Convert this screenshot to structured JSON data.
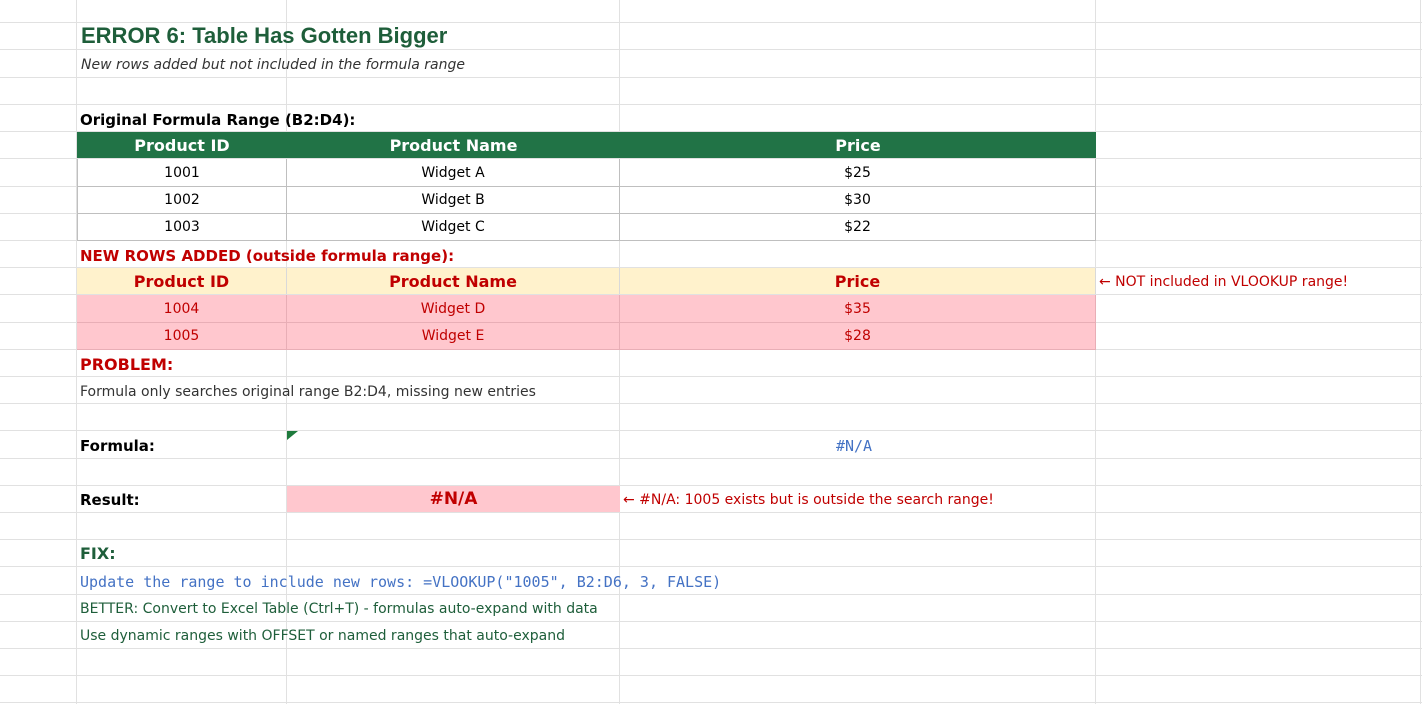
{
  "sheet": {
    "title": "ERROR 6: Table Has Gotten Bigger",
    "subtitle": "New rows added but not included in the formula range",
    "original_label": "Original Formula Range (B2:D4):",
    "columns": [
      "Product ID",
      "Product Name",
      "Price"
    ],
    "original_rows": [
      {
        "id": "1001",
        "name": "Widget A",
        "price": "$25"
      },
      {
        "id": "1002",
        "name": "Widget B",
        "price": "$30"
      },
      {
        "id": "1003",
        "name": "Widget C",
        "price": "$22"
      }
    ],
    "new_rows_label": "NEW ROWS ADDED (outside formula range):",
    "new_rows": [
      {
        "id": "1004",
        "name": "Widget D",
        "price": "$35"
      },
      {
        "id": "1005",
        "name": "Widget E",
        "price": "$28"
      }
    ],
    "new_rows_note": "← NOT included in VLOOKUP range!",
    "problem_label": "PROBLEM:",
    "problem_text": "Formula only searches original range B2:D4, missing new entries",
    "formula_label": "Formula:",
    "formula_value": "#N/A",
    "result_label": "Result:",
    "result_value": "#N/A",
    "result_note": "← #N/A: 1005 exists but is outside the search range!",
    "fix_label": "FIX:",
    "fix_lines": [
      "Update the range to include new rows: =VLOOKUP(\"1005\", B2:D6, 3, FALSE)",
      "BETTER: Convert to Excel Table (Ctrl+T) - formulas auto-expand with data",
      "Use dynamic ranges with OFFSET or named ranges that auto-expand"
    ]
  },
  "colors": {
    "header_green": "#217346",
    "title_green": "#1e5e3a",
    "error_red": "#c00000",
    "pink_fill": "#ffc7ce",
    "yellow_fill": "#fff2cc",
    "formula_blue": "#4472c4"
  }
}
